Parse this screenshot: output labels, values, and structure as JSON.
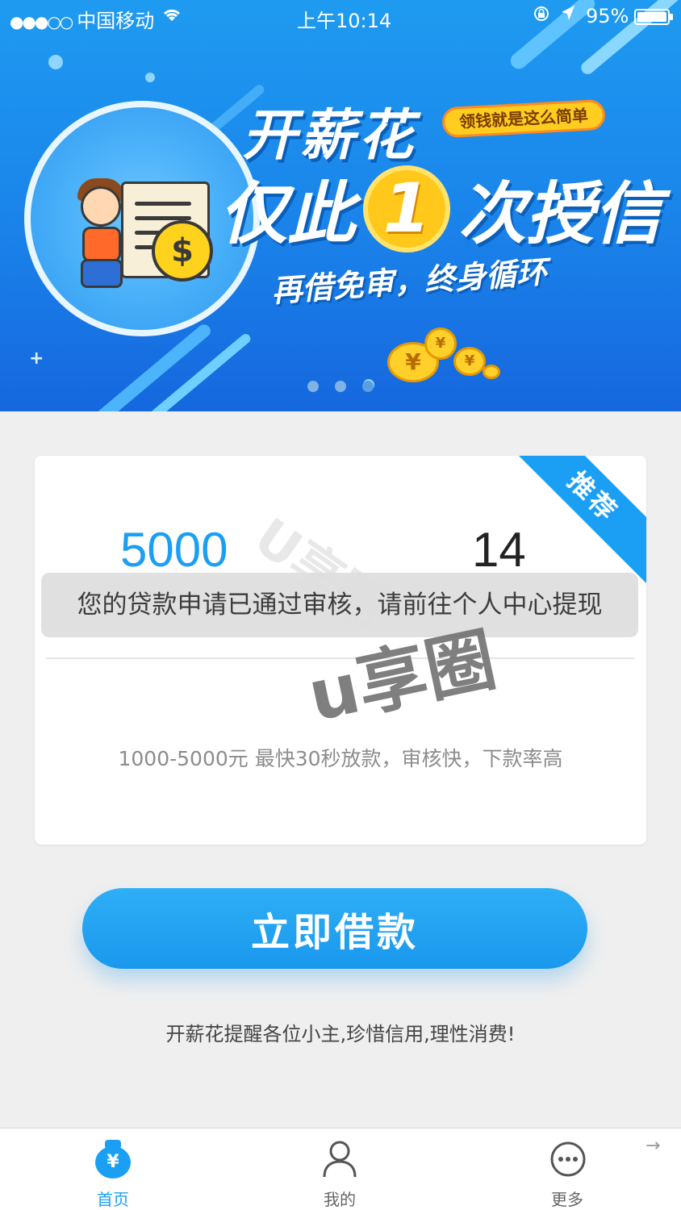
{
  "status_bar": {
    "carrier": "中国移动",
    "time": "上午10:14",
    "battery_pct": "95%",
    "icons": [
      "signal-dots-icon",
      "wifi-icon",
      "orientation-lock-icon",
      "location-arrow-icon",
      "battery-icon"
    ]
  },
  "banner": {
    "brand": "开薪花",
    "slogan_pill": "领钱就是这么简单",
    "headline_prefix": "仅此",
    "headline_number": "1",
    "headline_suffix": "次授信",
    "subline": "再借免审，终身循环",
    "coin_symbol": "$",
    "yen_symbol": "¥",
    "page_count": 3,
    "active_page": 3
  },
  "card": {
    "badge": "推荐",
    "amount": "5000",
    "term": "14",
    "description": "1000-5000元 最快30秒放款，审核快，下款率高"
  },
  "toast": {
    "message": "您的贷款申请已通过审核，请前往个人中心提现"
  },
  "watermark": {
    "text": "u享圈",
    "faint_text": "U享圈"
  },
  "cta": {
    "label": "立即借款"
  },
  "reminder": "开薪花提醒各位小主,珍惜信用,理性消费!",
  "tabbar": {
    "items": [
      {
        "label": "首页",
        "icon": "money-bag-icon",
        "active": true
      },
      {
        "label": "我的",
        "icon": "user-icon",
        "active": false
      },
      {
        "label": "更多",
        "icon": "more-dots-icon",
        "active": false
      }
    ]
  },
  "colors": {
    "accent": "#1a9ff5",
    "banner_blue": "#1a83ea",
    "coin_gold": "#ffc81a",
    "background": "#efefef"
  }
}
